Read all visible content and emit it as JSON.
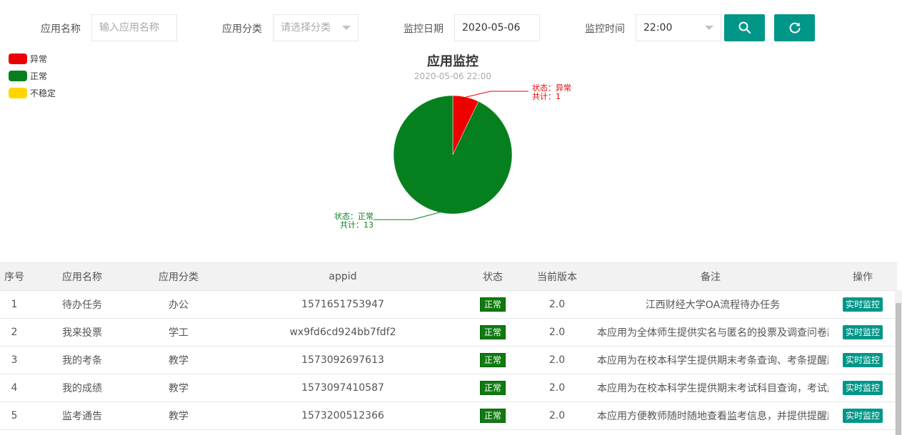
{
  "filters": {
    "app_name_label": "应用名称",
    "app_name_placeholder": "输入应用名称",
    "category_label": "应用分类",
    "category_placeholder": "请选择分类",
    "date_label": "监控日期",
    "date_value": "2020-05-06",
    "time_label": "监控时间",
    "time_value": "22:00",
    "search_icon": "search-icon",
    "refresh_icon": "refresh-icon"
  },
  "legend": [
    {
      "label": "异常",
      "color": "#ee0000"
    },
    {
      "label": "正常",
      "color": "#06801e"
    },
    {
      "label": "不稳定",
      "color": "#ffd700"
    }
  ],
  "chart": {
    "title": "应用监控",
    "subtitle": "2020-05-06 22:00"
  },
  "chart_data": {
    "type": "pie",
    "title": "应用监控",
    "subtitle": "2020-05-06 22:00",
    "slices": [
      {
        "name": "异常",
        "value": 1,
        "color": "#ee0000",
        "label_line1": "状态：异常",
        "label_line2": "共计：1"
      },
      {
        "name": "正常",
        "value": 13,
        "color": "#06801e",
        "label_line1": "状态：正常",
        "label_line2": "共计：13"
      }
    ],
    "legend": [
      "异常",
      "正常",
      "不稳定"
    ],
    "legend_placement": "top-left"
  },
  "table": {
    "headers": [
      "序号",
      "应用名称",
      "应用分类",
      "appid",
      "状态",
      "当前版本",
      "备注",
      "操作"
    ],
    "rows": [
      {
        "idx": "1",
        "name": "待办任务",
        "category": "办公",
        "appid": "1571651753947",
        "status": "正常",
        "version": "2.0",
        "remark": "江西财经大学OA流程待办任务",
        "op": "实时监控"
      },
      {
        "idx": "2",
        "name": "我来投票",
        "category": "学工",
        "appid": "wx9fd6cd924bb7fdf2",
        "status": "正常",
        "version": "2.0",
        "remark": "本应用为全体师生提供实名与匿名的投票及调查问卷服务",
        "op": "实时监控"
      },
      {
        "idx": "3",
        "name": "我的考条",
        "category": "教学",
        "appid": "1573092697613",
        "status": "正常",
        "version": "2.0",
        "remark": "本应用为在校本科学生提供期末考条查询、考条提醒服务",
        "op": "实时监控"
      },
      {
        "idx": "4",
        "name": "我的成绩",
        "category": "教学",
        "appid": "1573097410587",
        "status": "正常",
        "version": "2.0",
        "remark": "本应用为在校本科学生提供期末考试科目查询，考试成绩",
        "op": "实时监控"
      },
      {
        "idx": "5",
        "name": "监考通告",
        "category": "教学",
        "appid": "1573200512366",
        "status": "正常",
        "version": "2.0",
        "remark": "本应用方便教师随时随地查看监考信息，并提供提醒服务",
        "op": "实时监控"
      }
    ]
  }
}
